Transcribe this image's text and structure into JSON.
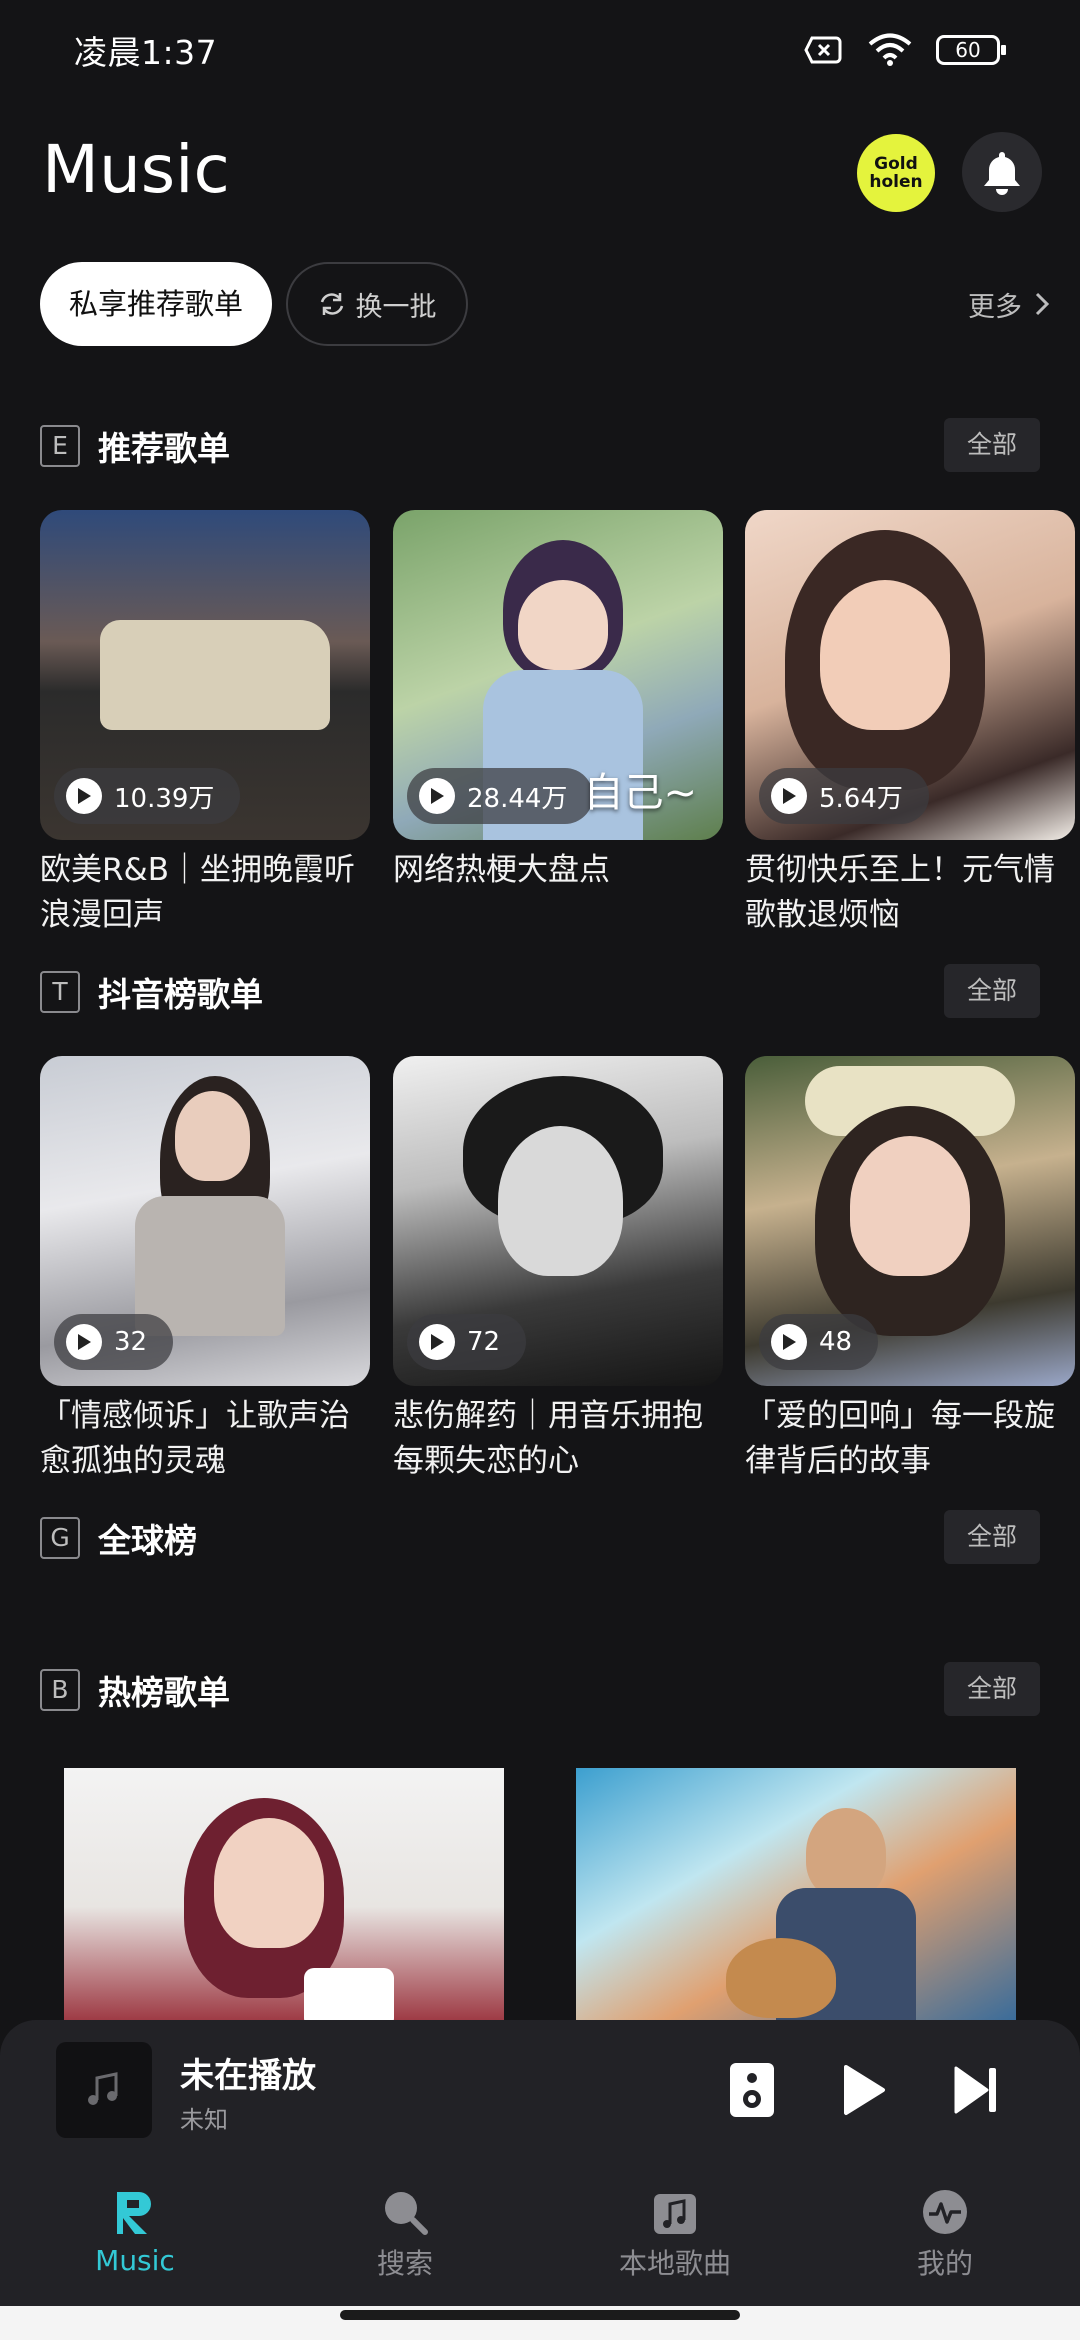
{
  "status_bar": {
    "time": "凌晨1:37",
    "battery": "60"
  },
  "header": {
    "title": "Music",
    "gold_badge": "Gold holen"
  },
  "pills": {
    "primary": "私享推荐歌单",
    "refresh": "换一批",
    "more": "更多"
  },
  "sections": {
    "recommended": {
      "letter": "E",
      "title": "推荐歌单",
      "all": "全部",
      "cards": [
        {
          "count": "10.39万",
          "title": "欧美R&B｜坐拥晚霞听浪漫回声"
        },
        {
          "count": "28.44万",
          "title": "网络热梗大盘点",
          "overlay": "自己~"
        },
        {
          "count": "5.64万",
          "title": "贯彻快乐至上！元气情歌散退烦恼"
        }
      ]
    },
    "douyin": {
      "letter": "T",
      "title": "抖音榜歌单",
      "all": "全部",
      "cards": [
        {
          "count": "32",
          "title": "「情感倾诉」让歌声治愈孤独的灵魂"
        },
        {
          "count": "72",
          "title": "悲伤解药｜用音乐拥抱每颗失恋的心"
        },
        {
          "count": "48",
          "title": "「爱的回响」每一段旋律背后的故事"
        }
      ]
    },
    "global": {
      "letter": "G",
      "title": "全球榜",
      "all": "全部"
    },
    "hot": {
      "letter": "B",
      "title": "热榜歌单",
      "all": "全部"
    }
  },
  "mini_player": {
    "title": "未在播放",
    "artist": "未知"
  },
  "bottom_nav": [
    {
      "label": "Music",
      "icon": "r-logo-icon",
      "active": true
    },
    {
      "label": "搜索",
      "icon": "search-icon",
      "active": false
    },
    {
      "label": "本地歌曲",
      "icon": "music-note-icon",
      "active": false
    },
    {
      "label": "我的",
      "icon": "profile-pulse-icon",
      "active": false
    }
  ],
  "colors": {
    "accent": "#33c9d6",
    "gold": "#e4f33d",
    "background": "#141416"
  }
}
